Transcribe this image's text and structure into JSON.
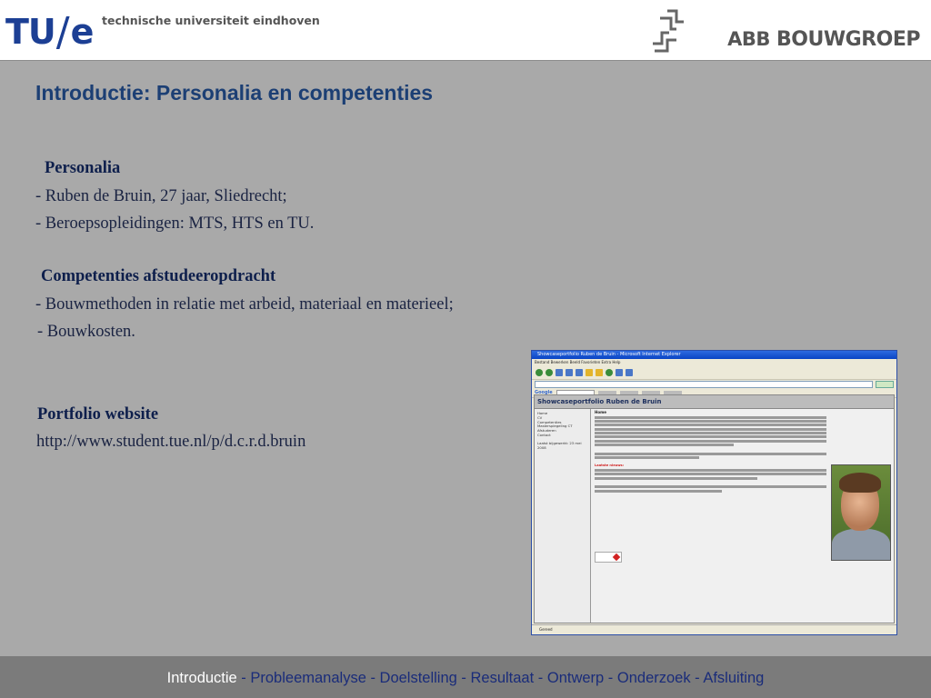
{
  "header": {
    "tue_mark": "TU",
    "tue_slash": "/",
    "tue_e": "e",
    "tue_name": "technische universiteit eindhoven",
    "abb_text": "ABB",
    "bouwgroep_text": "BOUWGROEP"
  },
  "slide": {
    "title": "Introductie: Personalia en competenties",
    "sections": {
      "personalia_heading": "Personalia",
      "personalia_line1": "- Ruben de Bruin, 27 jaar, Sliedrecht;",
      "personalia_line2": "- Beroepsopleidingen: MTS, HTS en TU.",
      "competenties_heading": "Competenties afstudeeropdracht",
      "competenties_line1": "- Bouwmethoden in relatie met arbeid, materiaal en materieel;",
      "competenties_line2": "- Bouwkosten.",
      "portfolio_heading": "Portfolio website",
      "portfolio_url": "http://www.student.tue.nl/p/d.c.r.d.bruin"
    }
  },
  "screenshot": {
    "window_title": "Showcaseportfolio Ruben de Bruin - Microsoft Internet Explorer",
    "menu": "Bestand   Bewerken   Beeld   Favorieten   Extra   Help",
    "google_label": "Google",
    "site_title": "Showcaseportfolio Ruben de Bruin",
    "nav_items": [
      "Home",
      "CV",
      "Competenties",
      "Masterspiegeling CT",
      "Afstuderen",
      "Contact"
    ],
    "nav_note": "Laatst bijgewerkt: 23 mei 2008",
    "main_heading": "Home",
    "main_alert": "Laatste nieuws:",
    "status": "Gereed"
  },
  "footer": {
    "current": "Introductie",
    "rest": " - Probleemanalyse - Doelstelling - Resultaat - Ontwerp - Onderzoek - Afsluiting"
  },
  "colors": {
    "background": "#a9a9a9",
    "title": "#1c3f74",
    "footer_bg": "#7b7b7b",
    "footer_link": "#1a2c7a",
    "tue_blue": "#1c3f94"
  }
}
